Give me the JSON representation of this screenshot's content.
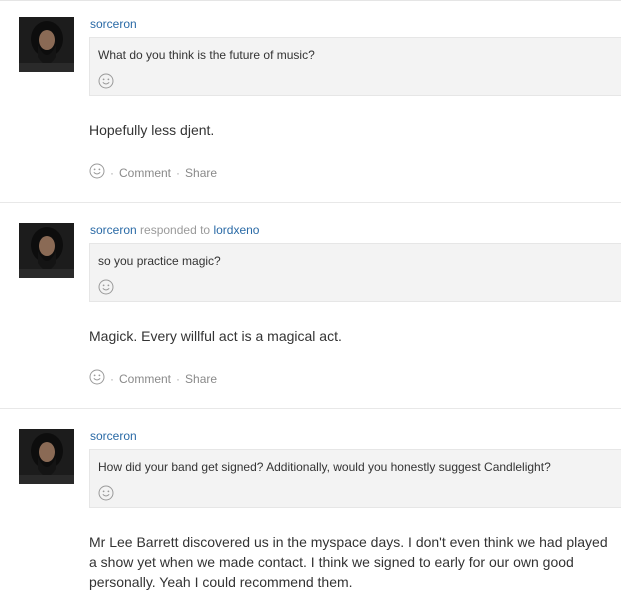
{
  "posts": [
    {
      "username": "sorceron",
      "responded_to_text": "",
      "responded_to_user": "",
      "question": "What do you think is the future of music?",
      "answer": "Hopefully less djent.",
      "action_comment": "Comment",
      "action_share": "Share",
      "separator": "·"
    },
    {
      "username": "sorceron",
      "responded_to_text": "responded to",
      "responded_to_user": "lordxeno",
      "question": "so you practice magic?",
      "answer": "Magick. Every willful act is a magical act.",
      "action_comment": "Comment",
      "action_share": "Share",
      "separator": "·"
    },
    {
      "username": "sorceron",
      "responded_to_text": "",
      "responded_to_user": "",
      "question": "How did your band get signed? Additionally, would you honestly suggest Candlelight?",
      "answer": "Mr Lee Barrett discovered us in the myspace days. I don't even think we had played a show yet when we made contact. I think we signed to early for our own good personally. Yeah I could recommend them.",
      "action_comment": "",
      "action_share": "",
      "separator": ""
    }
  ],
  "icons": {
    "smiley": "smiley-icon"
  },
  "colors": {
    "link": "#2a6aa6",
    "muted": "#9a9a9a",
    "question_bg": "#f3f3f3"
  }
}
